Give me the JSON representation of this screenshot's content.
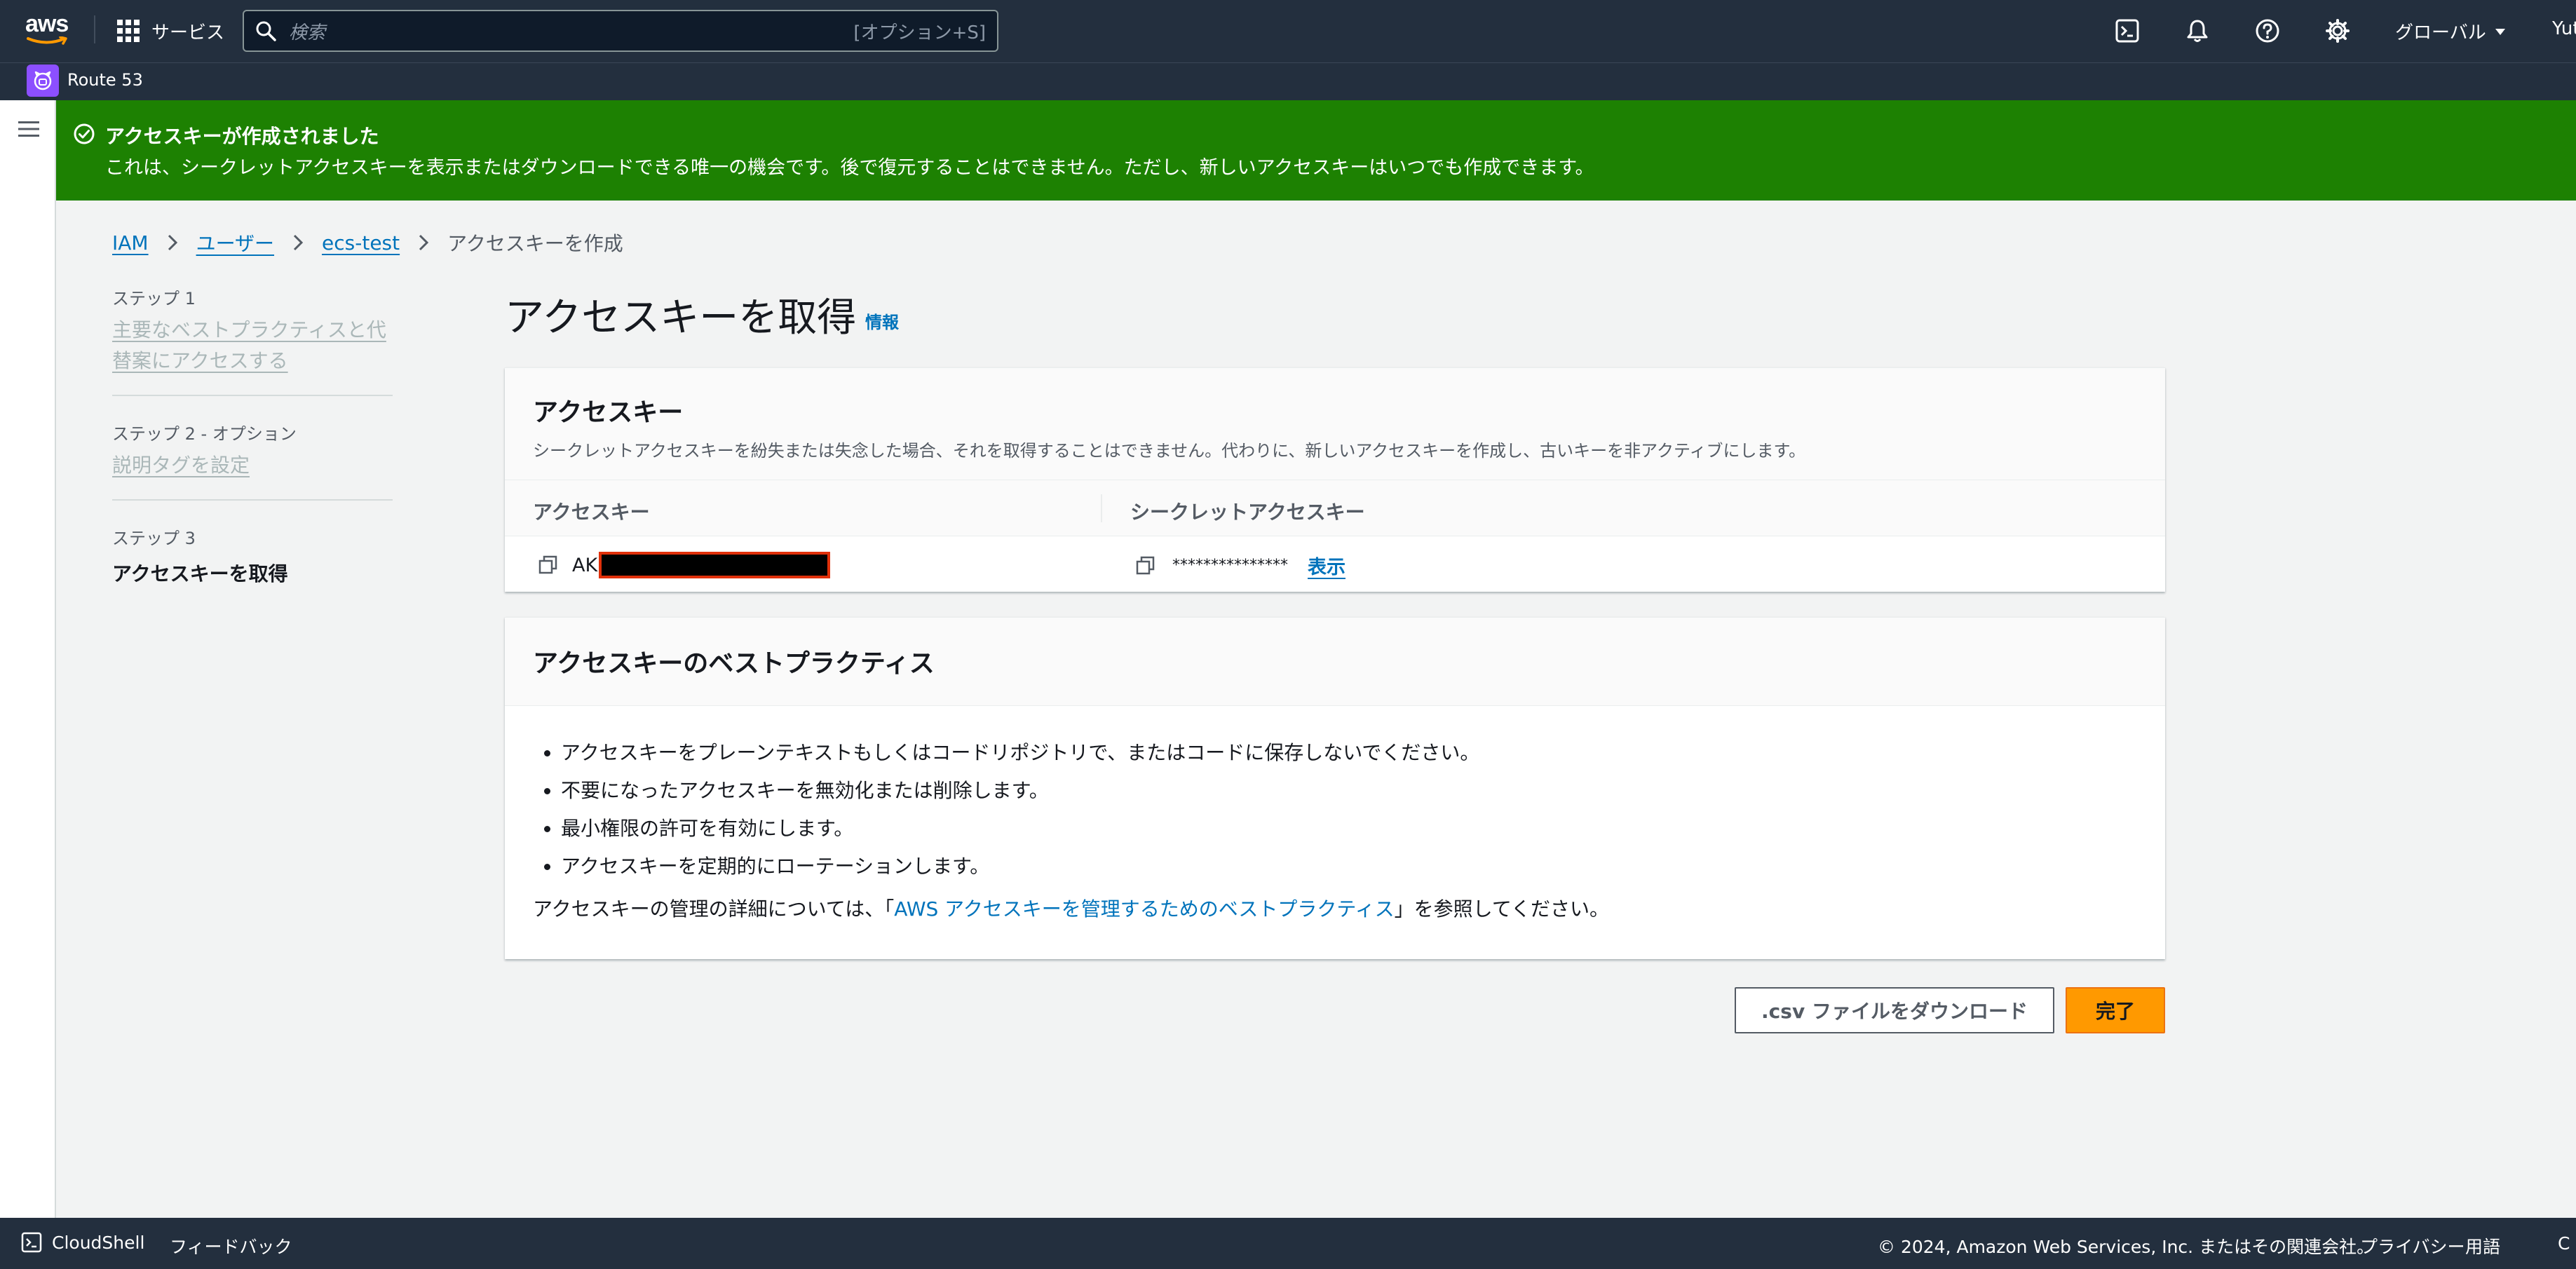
{
  "topnav": {
    "logo_text": "aws",
    "services_label": "サービス",
    "search_placeholder": "検索",
    "search_shortcut": "[オプション+S]",
    "region_label": "グローバル",
    "user_label": "Yut"
  },
  "subnav": {
    "service_label": "Route 53"
  },
  "flash": {
    "title": "アクセスキーが作成されました",
    "message": "これは、シークレットアクセスキーを表示またはダウンロードできる唯一の機会です。後で復元することはできません。ただし、新しいアクセスキーはいつでも作成できます。"
  },
  "breadcrumb": {
    "items": [
      "IAM",
      "ユーザー",
      "ecs-test"
    ],
    "current": "アクセスキーを作成"
  },
  "steps": [
    {
      "meta": "ステップ 1",
      "label": "主要なベストプラクティスと代替案にアクセスする"
    },
    {
      "meta": "ステップ 2 - オプション",
      "label": "説明タグを設定"
    },
    {
      "meta": "ステップ 3",
      "label": "アクセスキーを取得"
    }
  ],
  "page": {
    "title": "アクセスキーを取得",
    "info_label": "情報"
  },
  "access_key_panel": {
    "title": "アクセスキー",
    "description": "シークレットアクセスキーを紛失または失念した場合、それを取得することはできません。代わりに、新しいアクセスキーを作成し、古いキーを非アクティブにします。",
    "col_access_key": "アクセスキー",
    "col_secret_key": "シークレットアクセスキー",
    "access_key_prefix": "AK",
    "secret_masked": "***************",
    "show_label": "表示"
  },
  "best_practices": {
    "title": "アクセスキーのベストプラクティス",
    "items": [
      "アクセスキーをプレーンテキストもしくはコードリポジトリで、またはコードに保存しないでください。",
      "不要になったアクセスキーを無効化または削除します。",
      "最小権限の許可を有効にします。",
      "アクセスキーを定期的にローテーションします。"
    ],
    "footer_prefix": "アクセスキーの管理の詳細については、「",
    "footer_link": "AWS アクセスキーを管理するためのベストプラクティス",
    "footer_suffix": "」を参照してください。"
  },
  "buttons": {
    "download_csv": ".csv ファイルをダウンロード",
    "done": "完了"
  },
  "footer": {
    "cloudshell": "CloudShell",
    "feedback": "フィードバック",
    "copyright": "© 2024, Amazon Web Services, Inc. またはその関連会社。",
    "privacy": "プライバシー",
    "terms": "用語",
    "cookie": "C"
  }
}
